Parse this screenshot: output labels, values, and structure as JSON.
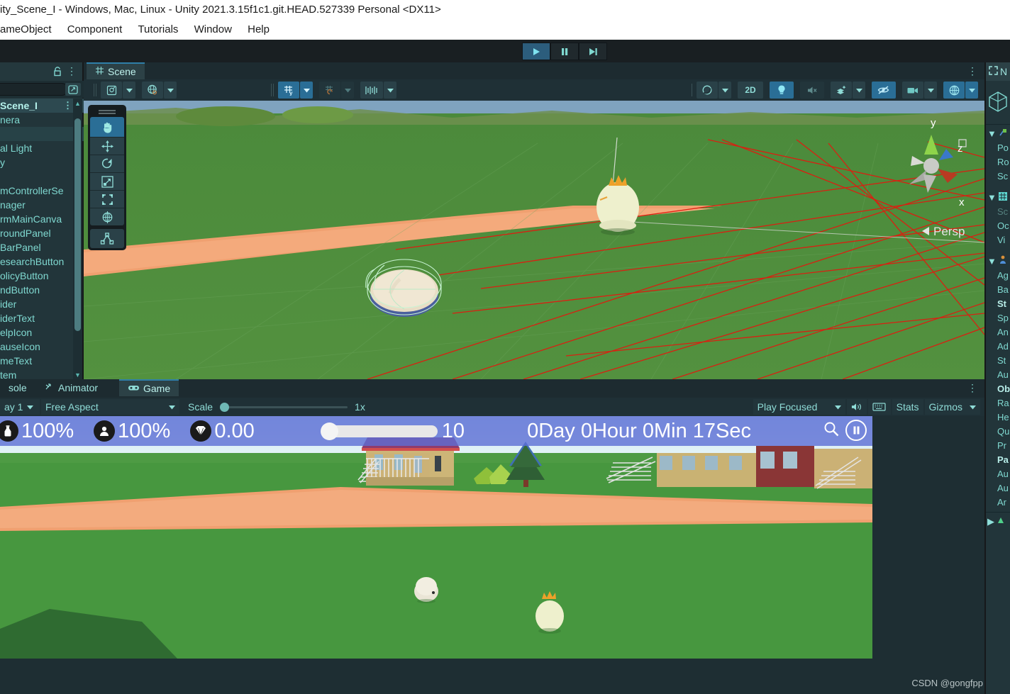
{
  "window": {
    "title": "ity_Scene_I - Windows, Mac, Linux - Unity 2021.3.15f1c1.git.HEAD.527339 Personal <DX11>"
  },
  "menubar": {
    "items": [
      "ameObject",
      "Component",
      "Tutorials",
      "Window",
      "Help"
    ]
  },
  "toolbar": {
    "play_label": "play-icon",
    "pause_label": "pause-icon",
    "step_label": "step-icon"
  },
  "hierarchy": {
    "lock_icon": "lock-icon",
    "options_icon": "kebab-menu-icon",
    "search_placeholder": "",
    "search_value": "",
    "sort_icon": "sort-icon",
    "items": [
      {
        "label": "Scene_I",
        "kind": "scene-root"
      },
      {
        "label": "nera",
        "kind": "item"
      },
      {
        "label": "",
        "kind": "selected"
      },
      {
        "label": "al Light",
        "kind": "item"
      },
      {
        "label": "y",
        "kind": "item"
      },
      {
        "label": "",
        "kind": "item"
      },
      {
        "label": "mControllerSe",
        "kind": "item"
      },
      {
        "label": "nager",
        "kind": "item"
      },
      {
        "label": "rmMainCanva",
        "kind": "item"
      },
      {
        "label": "roundPanel",
        "kind": "item"
      },
      {
        "label": "BarPanel",
        "kind": "item"
      },
      {
        "label": "esearchButton",
        "kind": "item"
      },
      {
        "label": "olicyButton",
        "kind": "item"
      },
      {
        "label": "ndButton",
        "kind": "item"
      },
      {
        "label": "ider",
        "kind": "item"
      },
      {
        "label": "iderText",
        "kind": "item"
      },
      {
        "label": "elpIcon",
        "kind": "item"
      },
      {
        "label": "auseIcon",
        "kind": "item"
      },
      {
        "label": "meText",
        "kind": "item"
      },
      {
        "label": "tem",
        "kind": "item"
      }
    ]
  },
  "scene": {
    "tab_label": "Scene",
    "tab_icon": "grid-hash-icon",
    "options_icon": "kebab-menu-icon",
    "toolbar": {
      "draw_mode_icon": "shading-mode-icon",
      "draw_mode_arrow": "chevron-down-icon",
      "lighting_icon": "globe-lighting-icon",
      "lighting_arrow": "chevron-down-icon",
      "grid_icon": "grid-axis-y-icon",
      "grid_arrow": "chevron-down-icon",
      "snap_icon": "grid-snap-icon",
      "snap_arrow": "chevron-down-icon",
      "ruler_icon": "ruler-icon",
      "ruler_arrow": "chevron-down-icon",
      "gizmo_sphere_icon": "sphere-gizmo-icon",
      "gizmo_sphere_arrow": "chevron-down-icon",
      "toggle_2d": "2D",
      "light_icon": "lightbulb-icon",
      "audio_icon": "audio-mute-icon",
      "fx_icon": "effects-icon",
      "fx_arrow": "chevron-down-icon",
      "hidden_icon": "eye-visibility-icon",
      "camera_icon": "camera-icon",
      "camera_arrow": "chevron-down-icon",
      "gizmos_icon": "gizmos-globe-icon",
      "gizmos_arrow": "chevron-down-icon"
    },
    "tools": [
      {
        "name": "hand-tool",
        "active": true
      },
      {
        "name": "move-tool",
        "active": false
      },
      {
        "name": "rotate-tool",
        "active": false
      },
      {
        "name": "scale-tool",
        "active": false
      },
      {
        "name": "rect-tool",
        "active": false
      },
      {
        "name": "transform-tool",
        "active": false
      },
      {
        "name": "custom-editor-tool",
        "active": false
      }
    ],
    "gizmo": {
      "x_label": "x",
      "y_label": "y",
      "z_label": "z",
      "persp_label": "Persp",
      "persp_arrow": "◀",
      "lock_icon": "lock-icon"
    }
  },
  "game": {
    "tabs": [
      {
        "label": "sole",
        "icon": "console-icon",
        "active": false
      },
      {
        "label": "Animator",
        "icon": "animator-icon",
        "active": false
      },
      {
        "label": "Game",
        "icon": "gamepad-icon",
        "active": true
      }
    ],
    "options_icon": "kebab-menu-icon",
    "display": "ay 1",
    "aspect": "Free Aspect",
    "scale_label": "Scale",
    "scale_value": "1x",
    "play_mode": "Play Focused",
    "mute_icon": "speaker-icon",
    "stats_button": "Stats",
    "gizmos_button": "Gizmos",
    "gizmos_arrow": "chevron-down-icon",
    "keyboard_icon": "keyboard-icon"
  },
  "hud": {
    "food_icon": "food-bottle-icon",
    "food_value": "100%",
    "population_icon": "person-icon",
    "population_value": "100%",
    "gem_icon": "diamond-icon",
    "gem_value": "0.00",
    "speed_value": "10",
    "time_value": "0Day 0Hour 0Min 17Sec",
    "search_icon": "magnifier-icon",
    "pause_icon": "pause-icon"
  },
  "inspector": {
    "tab_label": "N",
    "tab_icon": "expand-icon",
    "preview_icon": "prefab-cube-icon",
    "sections": [
      {
        "type": "header",
        "icon": "transform-icon",
        "label": ""
      },
      {
        "type": "row",
        "label": "Po"
      },
      {
        "type": "row",
        "label": "Ro"
      },
      {
        "type": "row",
        "label": "Sc"
      },
      {
        "type": "header",
        "icon": "grid-hash-icon",
        "label": ""
      },
      {
        "type": "row",
        "label": "Sc",
        "muted": true
      },
      {
        "type": "row",
        "label": "Oc"
      },
      {
        "type": "row",
        "label": "Vi"
      },
      {
        "type": "header",
        "icon": "character-icon",
        "label": ""
      },
      {
        "type": "row",
        "label": "Ag"
      },
      {
        "type": "row",
        "label": "Ba"
      },
      {
        "type": "row",
        "label": "St",
        "bold": true
      },
      {
        "type": "row",
        "label": "Sp"
      },
      {
        "type": "row",
        "label": "An"
      },
      {
        "type": "row",
        "label": "Ad"
      },
      {
        "type": "row",
        "label": "St"
      },
      {
        "type": "row",
        "label": "Au"
      },
      {
        "type": "row",
        "label": "Ob",
        "bold": true
      },
      {
        "type": "row",
        "label": "Ra"
      },
      {
        "type": "row",
        "label": "He"
      },
      {
        "type": "row",
        "label": "Qu"
      },
      {
        "type": "row",
        "label": "Pr"
      },
      {
        "type": "row",
        "label": "Pa",
        "bold": true
      },
      {
        "type": "row",
        "label": "Au"
      },
      {
        "type": "row",
        "label": "Au"
      },
      {
        "type": "row",
        "label": "Ar"
      },
      {
        "type": "footer",
        "icon": "expand-arrow-icon",
        "label": ""
      }
    ]
  },
  "watermark": {
    "text": "CSDN @gongfpp"
  },
  "colors": {
    "accent_blue": "#2a6e96",
    "panel_bg": "#22353a",
    "teal_text": "#7fd8d0",
    "hud_blue": "#5c6ed4",
    "scene_ground": "#4f8a3c",
    "path_orange": "#f0a070"
  }
}
